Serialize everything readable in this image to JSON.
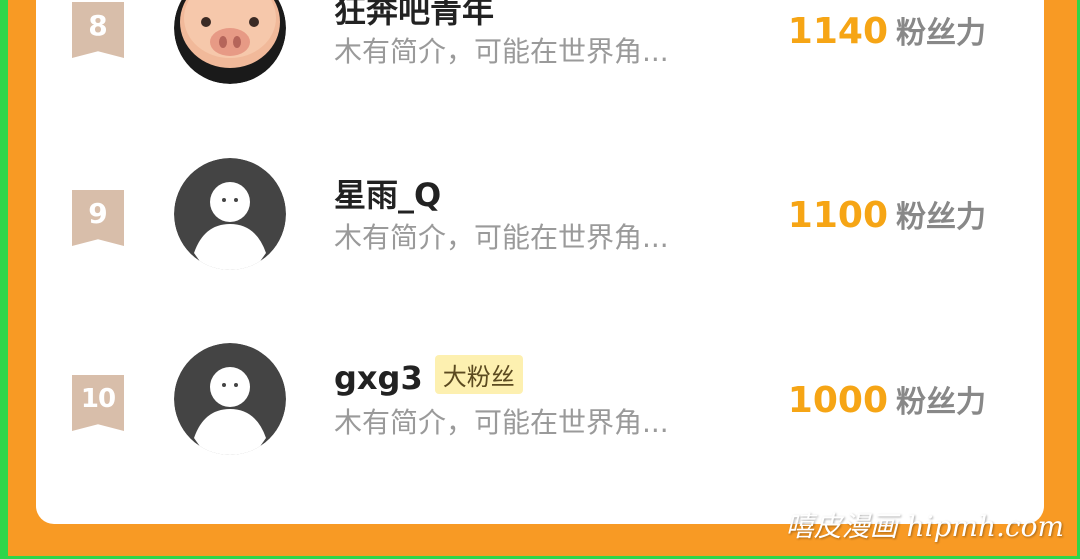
{
  "ranking": [
    {
      "rank": "8",
      "name": "狂奔吧青年",
      "badge": "",
      "bio": "木有简介，可能在世界角...",
      "score": "1140",
      "unit": "粉丝力",
      "avatar": "pig-avatar"
    },
    {
      "rank": "9",
      "name": "星雨_Q",
      "badge": "",
      "bio": "木有简介，可能在世界角...",
      "score": "1100",
      "unit": "粉丝力",
      "avatar": "default-avatar"
    },
    {
      "rank": "10",
      "name": "gxg3",
      "badge": "大粉丝",
      "bio": "木有简介，可能在世界角...",
      "score": "1000",
      "unit": "粉丝力",
      "avatar": "default-avatar"
    }
  ],
  "colors": {
    "background": "#f89a24",
    "accent": "#f6a515",
    "rank_ribbon": "#d8beaa",
    "badge_bg": "#fdf0b0"
  },
  "watermark": "嘻皮漫画 hipmh.com"
}
